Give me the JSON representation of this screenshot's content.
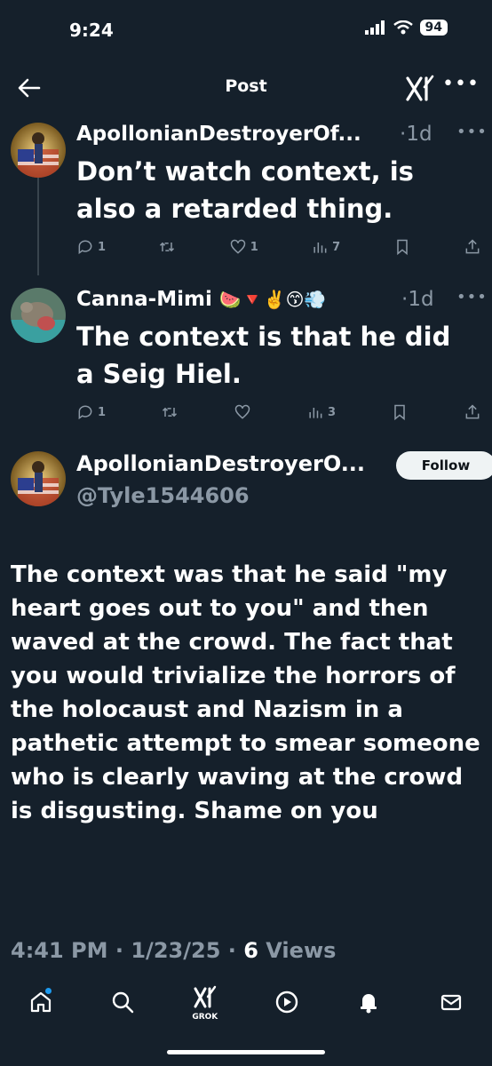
{
  "status_bar": {
    "time": "9:24",
    "battery": "94"
  },
  "header": {
    "title": "Post"
  },
  "reply1": {
    "author": "ApollonianDestroyerOf...",
    "time": "1d",
    "text": "Don’t watch context, is also a retarded thing.",
    "replies": "1",
    "likes": "1",
    "views": "7"
  },
  "reply2": {
    "author": "Canna-Mimi",
    "emojis": "🍉🔻✌️😙💨",
    "time": "1d",
    "text": "The context is that he did a Seig Hiel.",
    "replies": "1",
    "views": "3"
  },
  "main_post": {
    "author": "ApollonianDestroyerO...",
    "handle": "@Tyle1544606",
    "follow_label": "Follow",
    "text": "The context was that he said \"my heart goes out to you\" and then waved at the crowd. The fact that you would trivialize the horrors of the holocaust and Nazism in a pathetic attempt to smear someone who is clearly waving at the crowd is disgusting. Shame on you",
    "time": "4:41 PM",
    "date": "1/23/25",
    "views_count": "6",
    "views_label": "Views"
  },
  "nav": {
    "grok_label": "GROK"
  },
  "colors": {
    "background": "#15202b",
    "muted": "#8b98a5",
    "accent": "#1d9bf0"
  }
}
